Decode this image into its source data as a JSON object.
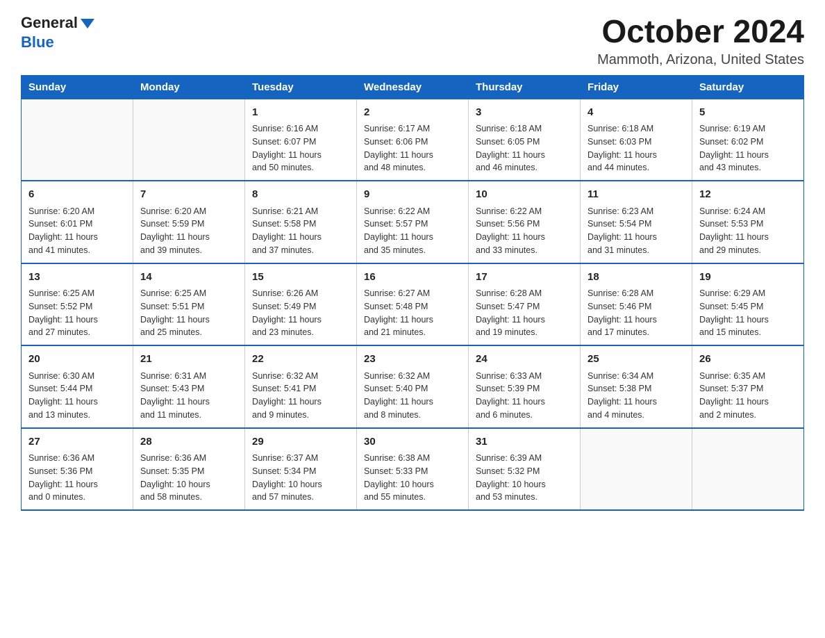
{
  "header": {
    "logo_general": "General",
    "logo_blue": "Blue",
    "month_title": "October 2024",
    "location": "Mammoth, Arizona, United States"
  },
  "days_of_week": [
    "Sunday",
    "Monday",
    "Tuesday",
    "Wednesday",
    "Thursday",
    "Friday",
    "Saturday"
  ],
  "weeks": [
    [
      {
        "day": "",
        "info": ""
      },
      {
        "day": "",
        "info": ""
      },
      {
        "day": "1",
        "info": "Sunrise: 6:16 AM\nSunset: 6:07 PM\nDaylight: 11 hours\nand 50 minutes."
      },
      {
        "day": "2",
        "info": "Sunrise: 6:17 AM\nSunset: 6:06 PM\nDaylight: 11 hours\nand 48 minutes."
      },
      {
        "day": "3",
        "info": "Sunrise: 6:18 AM\nSunset: 6:05 PM\nDaylight: 11 hours\nand 46 minutes."
      },
      {
        "day": "4",
        "info": "Sunrise: 6:18 AM\nSunset: 6:03 PM\nDaylight: 11 hours\nand 44 minutes."
      },
      {
        "day": "5",
        "info": "Sunrise: 6:19 AM\nSunset: 6:02 PM\nDaylight: 11 hours\nand 43 minutes."
      }
    ],
    [
      {
        "day": "6",
        "info": "Sunrise: 6:20 AM\nSunset: 6:01 PM\nDaylight: 11 hours\nand 41 minutes."
      },
      {
        "day": "7",
        "info": "Sunrise: 6:20 AM\nSunset: 5:59 PM\nDaylight: 11 hours\nand 39 minutes."
      },
      {
        "day": "8",
        "info": "Sunrise: 6:21 AM\nSunset: 5:58 PM\nDaylight: 11 hours\nand 37 minutes."
      },
      {
        "day": "9",
        "info": "Sunrise: 6:22 AM\nSunset: 5:57 PM\nDaylight: 11 hours\nand 35 minutes."
      },
      {
        "day": "10",
        "info": "Sunrise: 6:22 AM\nSunset: 5:56 PM\nDaylight: 11 hours\nand 33 minutes."
      },
      {
        "day": "11",
        "info": "Sunrise: 6:23 AM\nSunset: 5:54 PM\nDaylight: 11 hours\nand 31 minutes."
      },
      {
        "day": "12",
        "info": "Sunrise: 6:24 AM\nSunset: 5:53 PM\nDaylight: 11 hours\nand 29 minutes."
      }
    ],
    [
      {
        "day": "13",
        "info": "Sunrise: 6:25 AM\nSunset: 5:52 PM\nDaylight: 11 hours\nand 27 minutes."
      },
      {
        "day": "14",
        "info": "Sunrise: 6:25 AM\nSunset: 5:51 PM\nDaylight: 11 hours\nand 25 minutes."
      },
      {
        "day": "15",
        "info": "Sunrise: 6:26 AM\nSunset: 5:49 PM\nDaylight: 11 hours\nand 23 minutes."
      },
      {
        "day": "16",
        "info": "Sunrise: 6:27 AM\nSunset: 5:48 PM\nDaylight: 11 hours\nand 21 minutes."
      },
      {
        "day": "17",
        "info": "Sunrise: 6:28 AM\nSunset: 5:47 PM\nDaylight: 11 hours\nand 19 minutes."
      },
      {
        "day": "18",
        "info": "Sunrise: 6:28 AM\nSunset: 5:46 PM\nDaylight: 11 hours\nand 17 minutes."
      },
      {
        "day": "19",
        "info": "Sunrise: 6:29 AM\nSunset: 5:45 PM\nDaylight: 11 hours\nand 15 minutes."
      }
    ],
    [
      {
        "day": "20",
        "info": "Sunrise: 6:30 AM\nSunset: 5:44 PM\nDaylight: 11 hours\nand 13 minutes."
      },
      {
        "day": "21",
        "info": "Sunrise: 6:31 AM\nSunset: 5:43 PM\nDaylight: 11 hours\nand 11 minutes."
      },
      {
        "day": "22",
        "info": "Sunrise: 6:32 AM\nSunset: 5:41 PM\nDaylight: 11 hours\nand 9 minutes."
      },
      {
        "day": "23",
        "info": "Sunrise: 6:32 AM\nSunset: 5:40 PM\nDaylight: 11 hours\nand 8 minutes."
      },
      {
        "day": "24",
        "info": "Sunrise: 6:33 AM\nSunset: 5:39 PM\nDaylight: 11 hours\nand 6 minutes."
      },
      {
        "day": "25",
        "info": "Sunrise: 6:34 AM\nSunset: 5:38 PM\nDaylight: 11 hours\nand 4 minutes."
      },
      {
        "day": "26",
        "info": "Sunrise: 6:35 AM\nSunset: 5:37 PM\nDaylight: 11 hours\nand 2 minutes."
      }
    ],
    [
      {
        "day": "27",
        "info": "Sunrise: 6:36 AM\nSunset: 5:36 PM\nDaylight: 11 hours\nand 0 minutes."
      },
      {
        "day": "28",
        "info": "Sunrise: 6:36 AM\nSunset: 5:35 PM\nDaylight: 10 hours\nand 58 minutes."
      },
      {
        "day": "29",
        "info": "Sunrise: 6:37 AM\nSunset: 5:34 PM\nDaylight: 10 hours\nand 57 minutes."
      },
      {
        "day": "30",
        "info": "Sunrise: 6:38 AM\nSunset: 5:33 PM\nDaylight: 10 hours\nand 55 minutes."
      },
      {
        "day": "31",
        "info": "Sunrise: 6:39 AM\nSunset: 5:32 PM\nDaylight: 10 hours\nand 53 minutes."
      },
      {
        "day": "",
        "info": ""
      },
      {
        "day": "",
        "info": ""
      }
    ]
  ]
}
